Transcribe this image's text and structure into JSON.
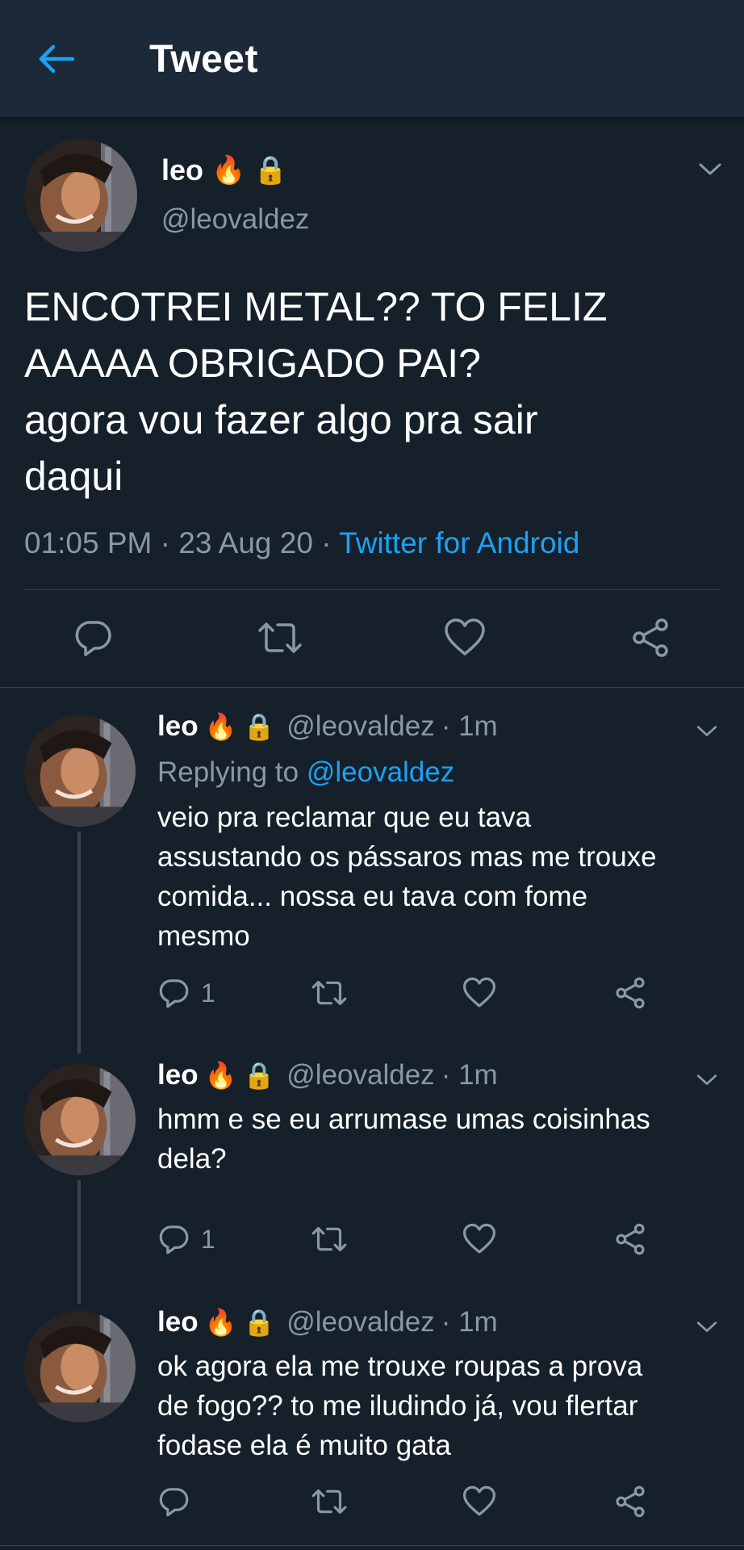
{
  "header": {
    "title": "Tweet"
  },
  "main_tweet": {
    "name": "leo",
    "emojis": [
      "🔥",
      "🔒"
    ],
    "handle": "@leovaldez",
    "text": "ENCOTREI METAL?? TO FELIZ\nAAAAA OBRIGADO PAI?\nagora vou fazer algo pra sair\ndaqui",
    "time": "01:05 PM",
    "date": "23 Aug 20",
    "source": "Twitter for Android",
    "sep": " · "
  },
  "replies": [
    {
      "name": "leo",
      "emojis": [
        "🔥",
        "🔒"
      ],
      "handle": "@leovaldez",
      "time": "· 1m",
      "replying_label": "Replying to",
      "replying_to": "@leovaldez",
      "text": "veio pra reclamar que eu tava\nassustando os pássaros mas me trouxe\ncomida... nossa eu tava com fome\nmesmo",
      "reply_count": "1"
    },
    {
      "name": "leo",
      "emojis": [
        "🔥",
        "🔒"
      ],
      "handle": "@leovaldez",
      "time": "· 1m",
      "text": "hmm e se eu arrumase umas coisinhas\ndela?",
      "reply_count": "1"
    },
    {
      "name": "leo",
      "emojis": [
        "🔥",
        "🔒"
      ],
      "handle": "@leovaldez",
      "time": "· 1m",
      "text": "ok agora ela me trouxe roupas a prova\nde fogo?? to me iludindo já, vou flertar\nfodase ela é muito gata",
      "reply_count": ""
    }
  ],
  "icons": {
    "back": "arrow-left-icon",
    "reply": "reply-icon",
    "retweet": "retweet-icon",
    "like": "heart-icon",
    "share": "share-icon",
    "caret": "chevron-down-icon"
  },
  "colors": {
    "background": "#15202b",
    "header": "#1c2938",
    "accent": "#1da1f2",
    "secondary_text": "#8899a6",
    "divider": "#38444d"
  }
}
